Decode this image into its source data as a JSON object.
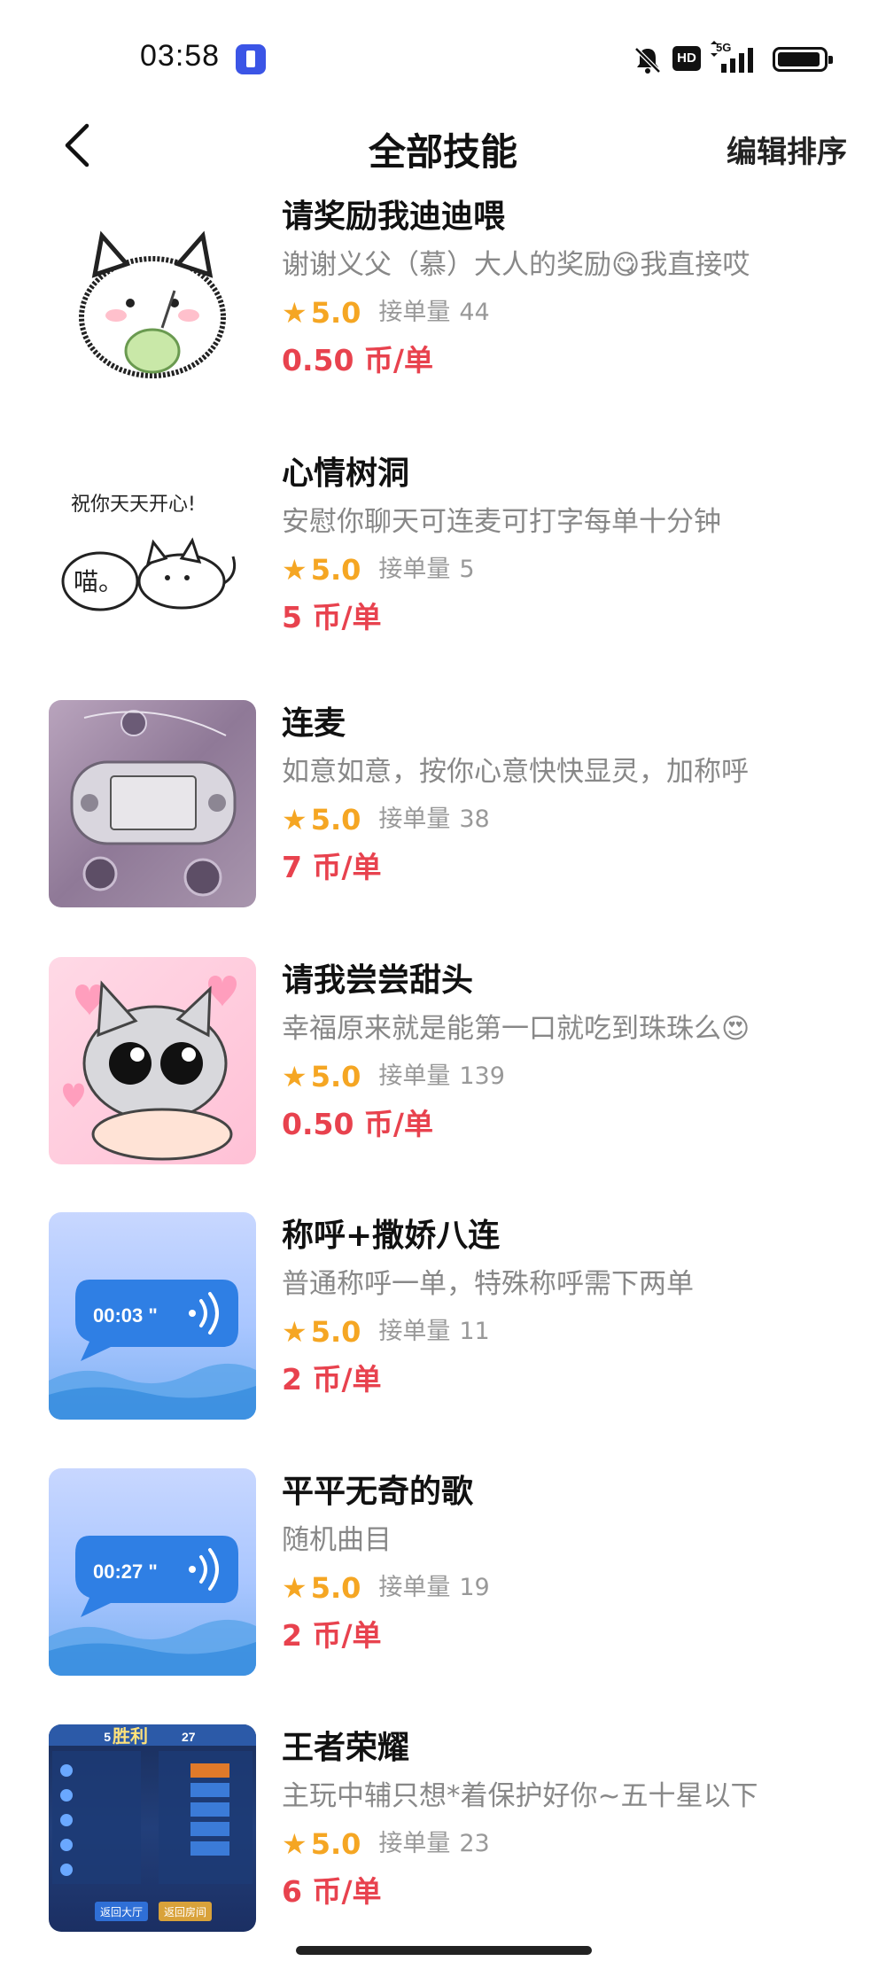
{
  "status_bar": {
    "time": "03:58",
    "network": "5G",
    "hd_label": "HD",
    "icons": [
      "torch-icon",
      "bell-off-icon",
      "hd-icon",
      "signal-icon",
      "battery-icon"
    ]
  },
  "nav": {
    "back_icon": "chevron-left-icon",
    "title": "全部技能",
    "edit_sort": "编辑排序"
  },
  "colors": {
    "accent_star": "#f5a623",
    "price_red": "#e8424e",
    "muted_text": "#888888"
  },
  "skills": [
    {
      "title": "请奖励我迪迪喂",
      "desc": "谢谢义父（慕）大人的奖励😋我直接哎",
      "star": "★",
      "rating": "5.0",
      "orders_label": "接单量",
      "orders": "44",
      "price": "0.50 币/单",
      "thumb": "cat-drinking"
    },
    {
      "title": "心情树洞",
      "desc": "安慰你聊天可连麦可打字每单十分钟",
      "star": "★",
      "rating": "5.0",
      "orders_label": "接单量",
      "orders": "5",
      "price": "5 币/单",
      "thumb": "cat-doodle",
      "thumb_text_1": "祝你天天开心!",
      "thumb_text_2": "喵。"
    },
    {
      "title": "连麦",
      "desc": "如意如意，按你心意快快显灵，加称呼",
      "star": "★",
      "rating": "5.0",
      "orders_label": "接单量",
      "orders": "38",
      "price": "7 币/单",
      "thumb": "psp-console"
    },
    {
      "title": "请我尝尝甜头",
      "desc": "幸福原来就是能第一口就吃到珠珠么😍",
      "star": "★",
      "rating": "5.0",
      "orders_label": "接单量",
      "orders": "139",
      "price": "0.50 币/单",
      "thumb": "cat-hearts"
    },
    {
      "title": "称呼+撒娇八连",
      "desc": "普通称呼一单，特殊称呼需下两单",
      "star": "★",
      "rating": "5.0",
      "orders_label": "接单量",
      "orders": "11",
      "price": "2 币/单",
      "thumb": "voice-bubble",
      "voice_duration": "00:03 \""
    },
    {
      "title": "平平无奇的歌",
      "desc": "随机曲目",
      "star": "★",
      "rating": "5.0",
      "orders_label": "接单量",
      "orders": "19",
      "price": "2 币/单",
      "thumb": "voice-bubble",
      "voice_duration": "00:27 \""
    },
    {
      "title": "王者荣耀",
      "desc": "主玩中辅只想*着保护好你~五十星以下",
      "star": "★",
      "rating": "5.0",
      "orders_label": "接单量",
      "orders": "23",
      "price": "6 币/单",
      "thumb": "game-result",
      "game_text": "胜利",
      "game_score_left": "5",
      "game_score_right": "27",
      "game_btn_1": "返回大厅",
      "game_btn_2": "返回房间"
    }
  ]
}
